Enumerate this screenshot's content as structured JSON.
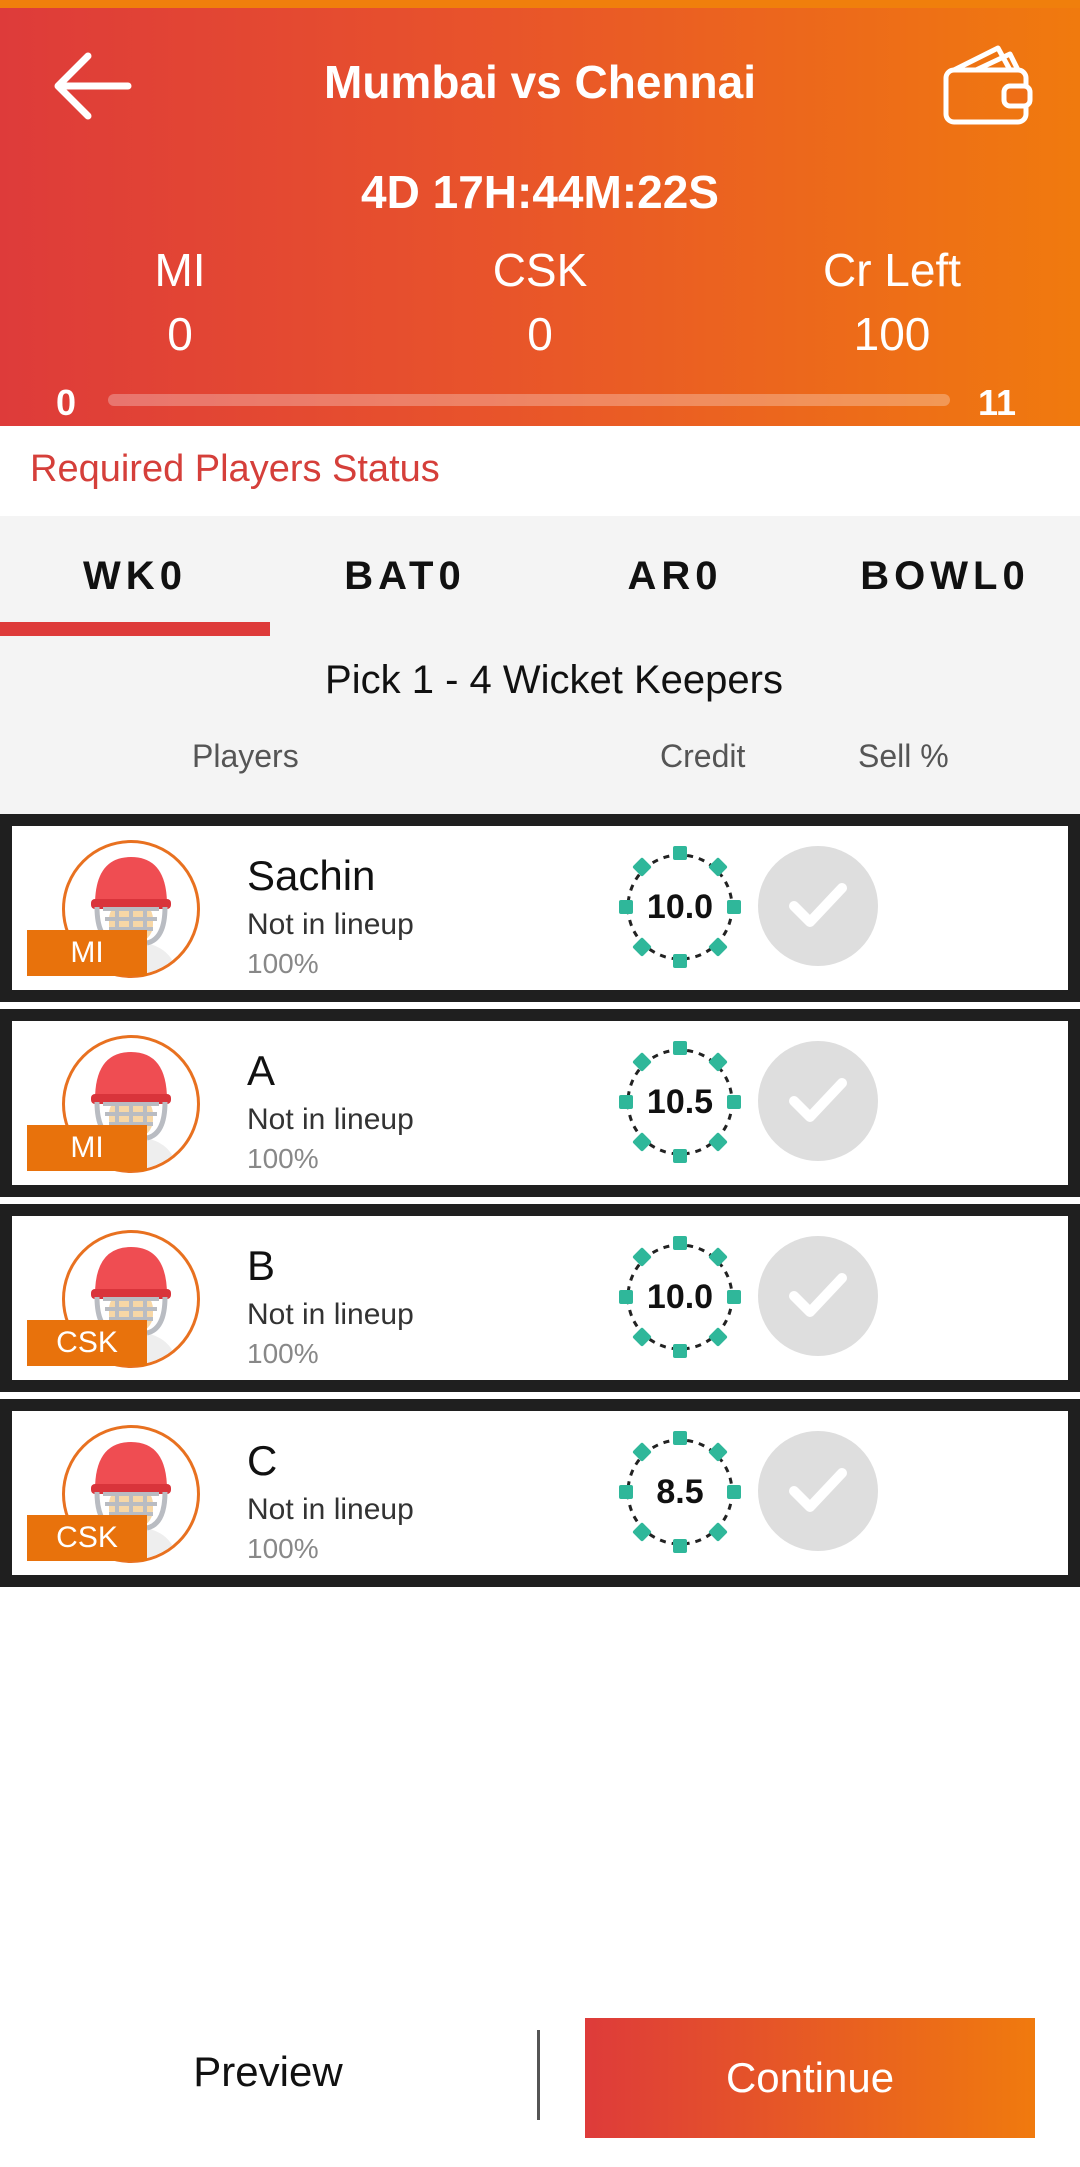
{
  "header": {
    "title": "Mumbai vs Chennai",
    "timer": "4D 17H:44M:22S",
    "stats": [
      {
        "label": "MI",
        "value": "0"
      },
      {
        "label": "CSK",
        "value": "0"
      },
      {
        "label": "Cr Left",
        "value": "100"
      }
    ],
    "range_min": "0",
    "range_max": "11",
    "progress_fraction": 0,
    "back_icon": "arrow-left-icon",
    "wallet_icon": "wallet-icon"
  },
  "required_status": "Required Players Status",
  "tabs": [
    {
      "label": "WK0",
      "active": true
    },
    {
      "label": "BAT0",
      "active": false
    },
    {
      "label": "AR0",
      "active": false
    },
    {
      "label": "BOWL0",
      "active": false
    }
  ],
  "pick_text": "Pick 1 - 4 Wicket Keepers",
  "columns": {
    "players": "Players",
    "credit": "Credit",
    "sell": "Sell %"
  },
  "players": [
    {
      "name": "Sachin",
      "team": "MI",
      "status": "Not in lineup",
      "sell": "100%",
      "credit": "10.0"
    },
    {
      "name": "A",
      "team": "MI",
      "status": "Not in lineup",
      "sell": "100%",
      "credit": "10.5"
    },
    {
      "name": "B",
      "team": "CSK",
      "status": "Not in lineup",
      "sell": "100%",
      "credit": "10.0"
    },
    {
      "name": "C",
      "team": "CSK",
      "status": "Not in lineup",
      "sell": "100%",
      "credit": "8.5"
    }
  ],
  "footer": {
    "preview": "Preview",
    "continue": "Continue"
  },
  "colors": {
    "accent_red": "#de3b3a",
    "accent_orange": "#f07a0e",
    "credit_teal": "#2fb79a",
    "team_tag": "#e8720c"
  }
}
